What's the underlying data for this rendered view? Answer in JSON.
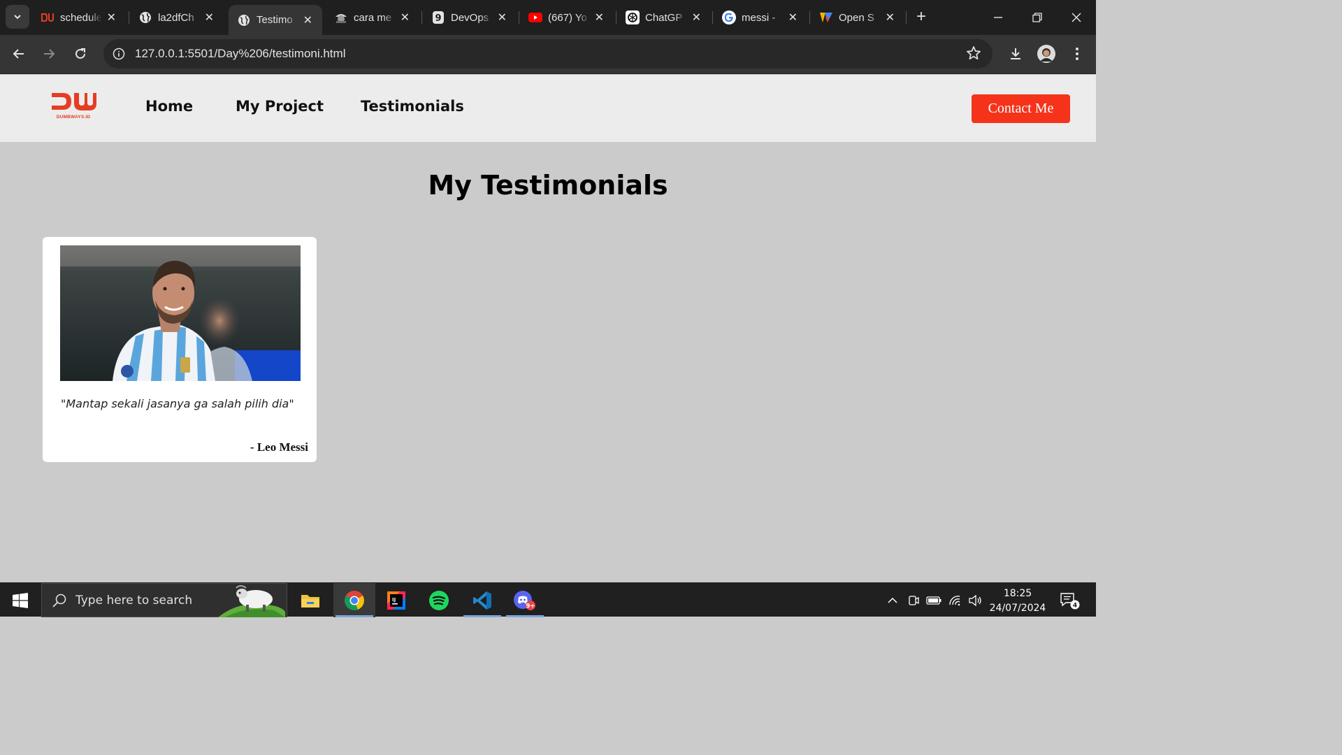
{
  "browser": {
    "tabs": [
      {
        "title": "schedule",
        "icon": "dumbways-icon"
      },
      {
        "title": "la2dfCh",
        "icon": "globe-icon"
      },
      {
        "title": "Testimo",
        "icon": "globe-icon",
        "active": true
      },
      {
        "title": "cara me",
        "icon": "pirate-icon"
      },
      {
        "title": "DevOps",
        "icon": "nine-icon"
      },
      {
        "title": "(667) Yo",
        "icon": "youtube-icon"
      },
      {
        "title": "ChatGP",
        "icon": "chatgpt-icon"
      },
      {
        "title": "messi -",
        "icon": "google-icon"
      },
      {
        "title": "Open S",
        "icon": "gradient-logo-icon"
      }
    ],
    "close_glyph": "✕",
    "new_tab_glyph": "+",
    "url_host": "127.0.0.1",
    "url_rest": ":5501/Day%206/testimoni.html"
  },
  "site": {
    "logo_text": "DUMBWAYS.ID",
    "nav": [
      "Home",
      "My Project",
      "Testimonials"
    ],
    "contact_label": "Contact Me",
    "title": "My Testimonials",
    "testimonial": {
      "quote": "\"Mantap sekali jasanya ga salah pilih dia\"",
      "author": "- Leo Messi"
    }
  },
  "taskbar": {
    "search_placeholder": "Type here to search",
    "time": "18:25",
    "date": "24/07/2024",
    "notification_count": "4",
    "discord_badge": "9+"
  },
  "colors": {
    "accent": "#f5331b",
    "page_bg": "#cbcbcb",
    "nav_bg": "#ececec"
  }
}
